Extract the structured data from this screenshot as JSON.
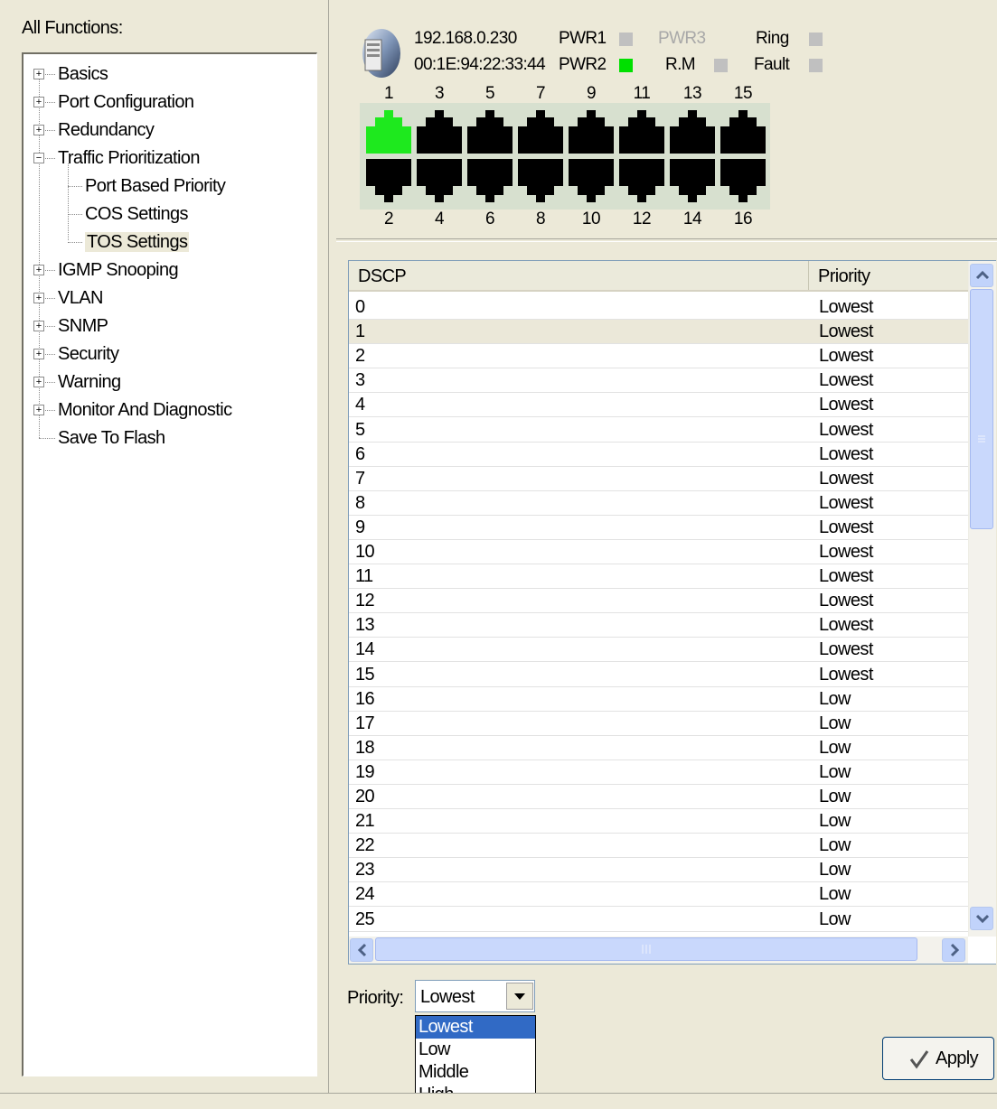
{
  "left_panel": {
    "title": "All Functions:",
    "tree": [
      {
        "label": "Basics",
        "expander": "+"
      },
      {
        "label": "Port Configuration",
        "expander": "+"
      },
      {
        "label": "Redundancy",
        "expander": "+"
      },
      {
        "label": "Traffic Prioritization",
        "expander": "−"
      },
      {
        "label": "Port Based Priority",
        "child": true
      },
      {
        "label": "COS Settings",
        "child": true
      },
      {
        "label": "TOS Settings",
        "child": true,
        "selected": true
      },
      {
        "label": "IGMP Snooping",
        "expander": "+"
      },
      {
        "label": "VLAN",
        "expander": "+"
      },
      {
        "label": "SNMP",
        "expander": "+"
      },
      {
        "label": "Security",
        "expander": "+"
      },
      {
        "label": "Warning",
        "expander": "+"
      },
      {
        "label": "Monitor And Diagnostic",
        "expander": "+"
      },
      {
        "label": "Save To Flash"
      }
    ]
  },
  "device": {
    "ip": "192.168.0.230",
    "mac": "00:1E:94:22:33:44",
    "indicators": {
      "pwr1": {
        "label": "PWR1",
        "color": "#c0c0c0"
      },
      "pwr2": {
        "label": "PWR2",
        "color": "#00e000"
      },
      "pwr3": {
        "label": "PWR3",
        "color": "#c0c0c0"
      },
      "rm": {
        "label": "R.M",
        "color": "#c0c0c0"
      },
      "ring": {
        "label": "Ring",
        "color": "#c0c0c0"
      },
      "fault": {
        "label": "Fault",
        "color": "#c0c0c0"
      }
    },
    "top_port_numbers": [
      "1",
      "3",
      "5",
      "7",
      "9",
      "11",
      "13",
      "15"
    ],
    "bottom_port_numbers": [
      "2",
      "4",
      "6",
      "8",
      "10",
      "12",
      "14",
      "16"
    ],
    "active_port_color": "#1ee91e",
    "inactive_port_color": "#000000"
  },
  "table": {
    "columns": [
      "DSCP",
      "Priority"
    ],
    "selected_row": "1",
    "rows": [
      [
        "0",
        "Lowest"
      ],
      [
        "1",
        "Lowest"
      ],
      [
        "2",
        "Lowest"
      ],
      [
        "3",
        "Lowest"
      ],
      [
        "4",
        "Lowest"
      ],
      [
        "5",
        "Lowest"
      ],
      [
        "6",
        "Lowest"
      ],
      [
        "7",
        "Lowest"
      ],
      [
        "8",
        "Lowest"
      ],
      [
        "9",
        "Lowest"
      ],
      [
        "10",
        "Lowest"
      ],
      [
        "11",
        "Lowest"
      ],
      [
        "12",
        "Lowest"
      ],
      [
        "13",
        "Lowest"
      ],
      [
        "14",
        "Lowest"
      ],
      [
        "15",
        "Lowest"
      ],
      [
        "16",
        "Low"
      ],
      [
        "17",
        "Low"
      ],
      [
        "18",
        "Low"
      ],
      [
        "19",
        "Low"
      ],
      [
        "20",
        "Low"
      ],
      [
        "21",
        "Low"
      ],
      [
        "22",
        "Low"
      ],
      [
        "23",
        "Low"
      ],
      [
        "24",
        "Low"
      ],
      [
        "25",
        "Low"
      ]
    ]
  },
  "controls": {
    "priority_label": "Priority:",
    "priority_value": "Lowest",
    "options": [
      "Lowest",
      "Low",
      "Middle",
      "High"
    ],
    "highlighted_option": "Lowest",
    "apply_label": "Apply"
  }
}
